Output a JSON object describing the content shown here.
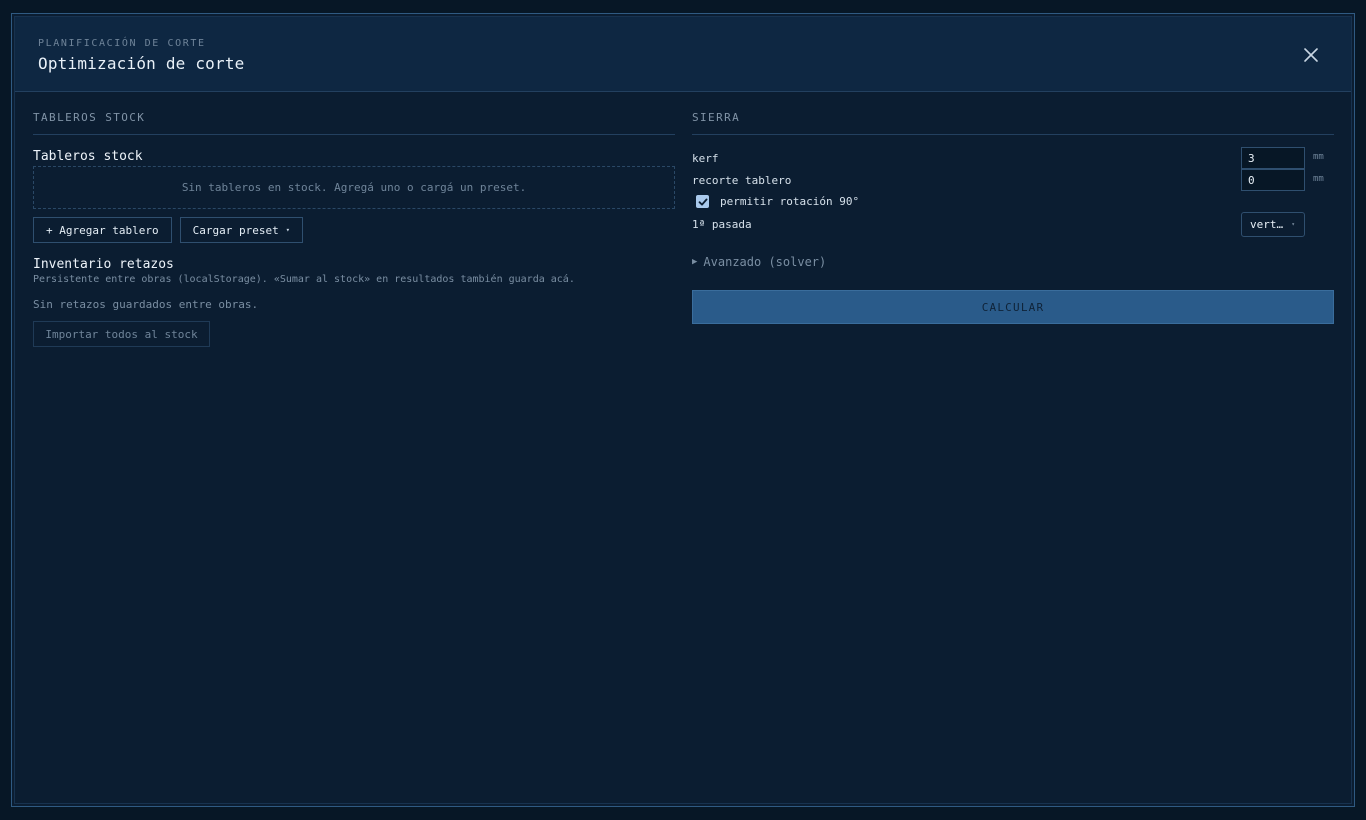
{
  "header": {
    "eyebrow": "PLANIFICACIÓN DE CORTE",
    "title": "Optimización de corte"
  },
  "stock": {
    "section_label": "TABLEROS STOCK",
    "heading": "Tableros stock",
    "empty_message": "Sin tableros en stock. Agregá uno o cargá un preset.",
    "add_button": "+ Agregar tablero",
    "preset_button": "Cargar preset",
    "preset_caret": "▾"
  },
  "inventory": {
    "heading": "Inventario retazos",
    "hint": "Persistente entre obras (localStorage). «Sumar al stock» en resultados también guarda acá.",
    "empty_message": "Sin retazos guardados entre obras.",
    "import_button": "Importar todos al stock"
  },
  "saw": {
    "section_label": "SIERRA",
    "kerf_label": "kerf",
    "kerf_value": "3",
    "kerf_unit": "mm",
    "trim_label": "recorte tablero",
    "trim_value": "0",
    "trim_unit": "mm",
    "rotation_label": "permitir rotación 90°",
    "rotation_checked": true,
    "first_pass_label": "1ª pasada",
    "first_pass_value": "vert…",
    "first_pass_caret": "▾",
    "advanced_label": "Avanzado (solver)",
    "calculate_button": "CALCULAR"
  },
  "colors": {
    "background": "#071726",
    "panel": "#0b1d31",
    "header": "#0e2742",
    "accent": "#2a5b8a",
    "checkbox": "#a9c9ec"
  }
}
